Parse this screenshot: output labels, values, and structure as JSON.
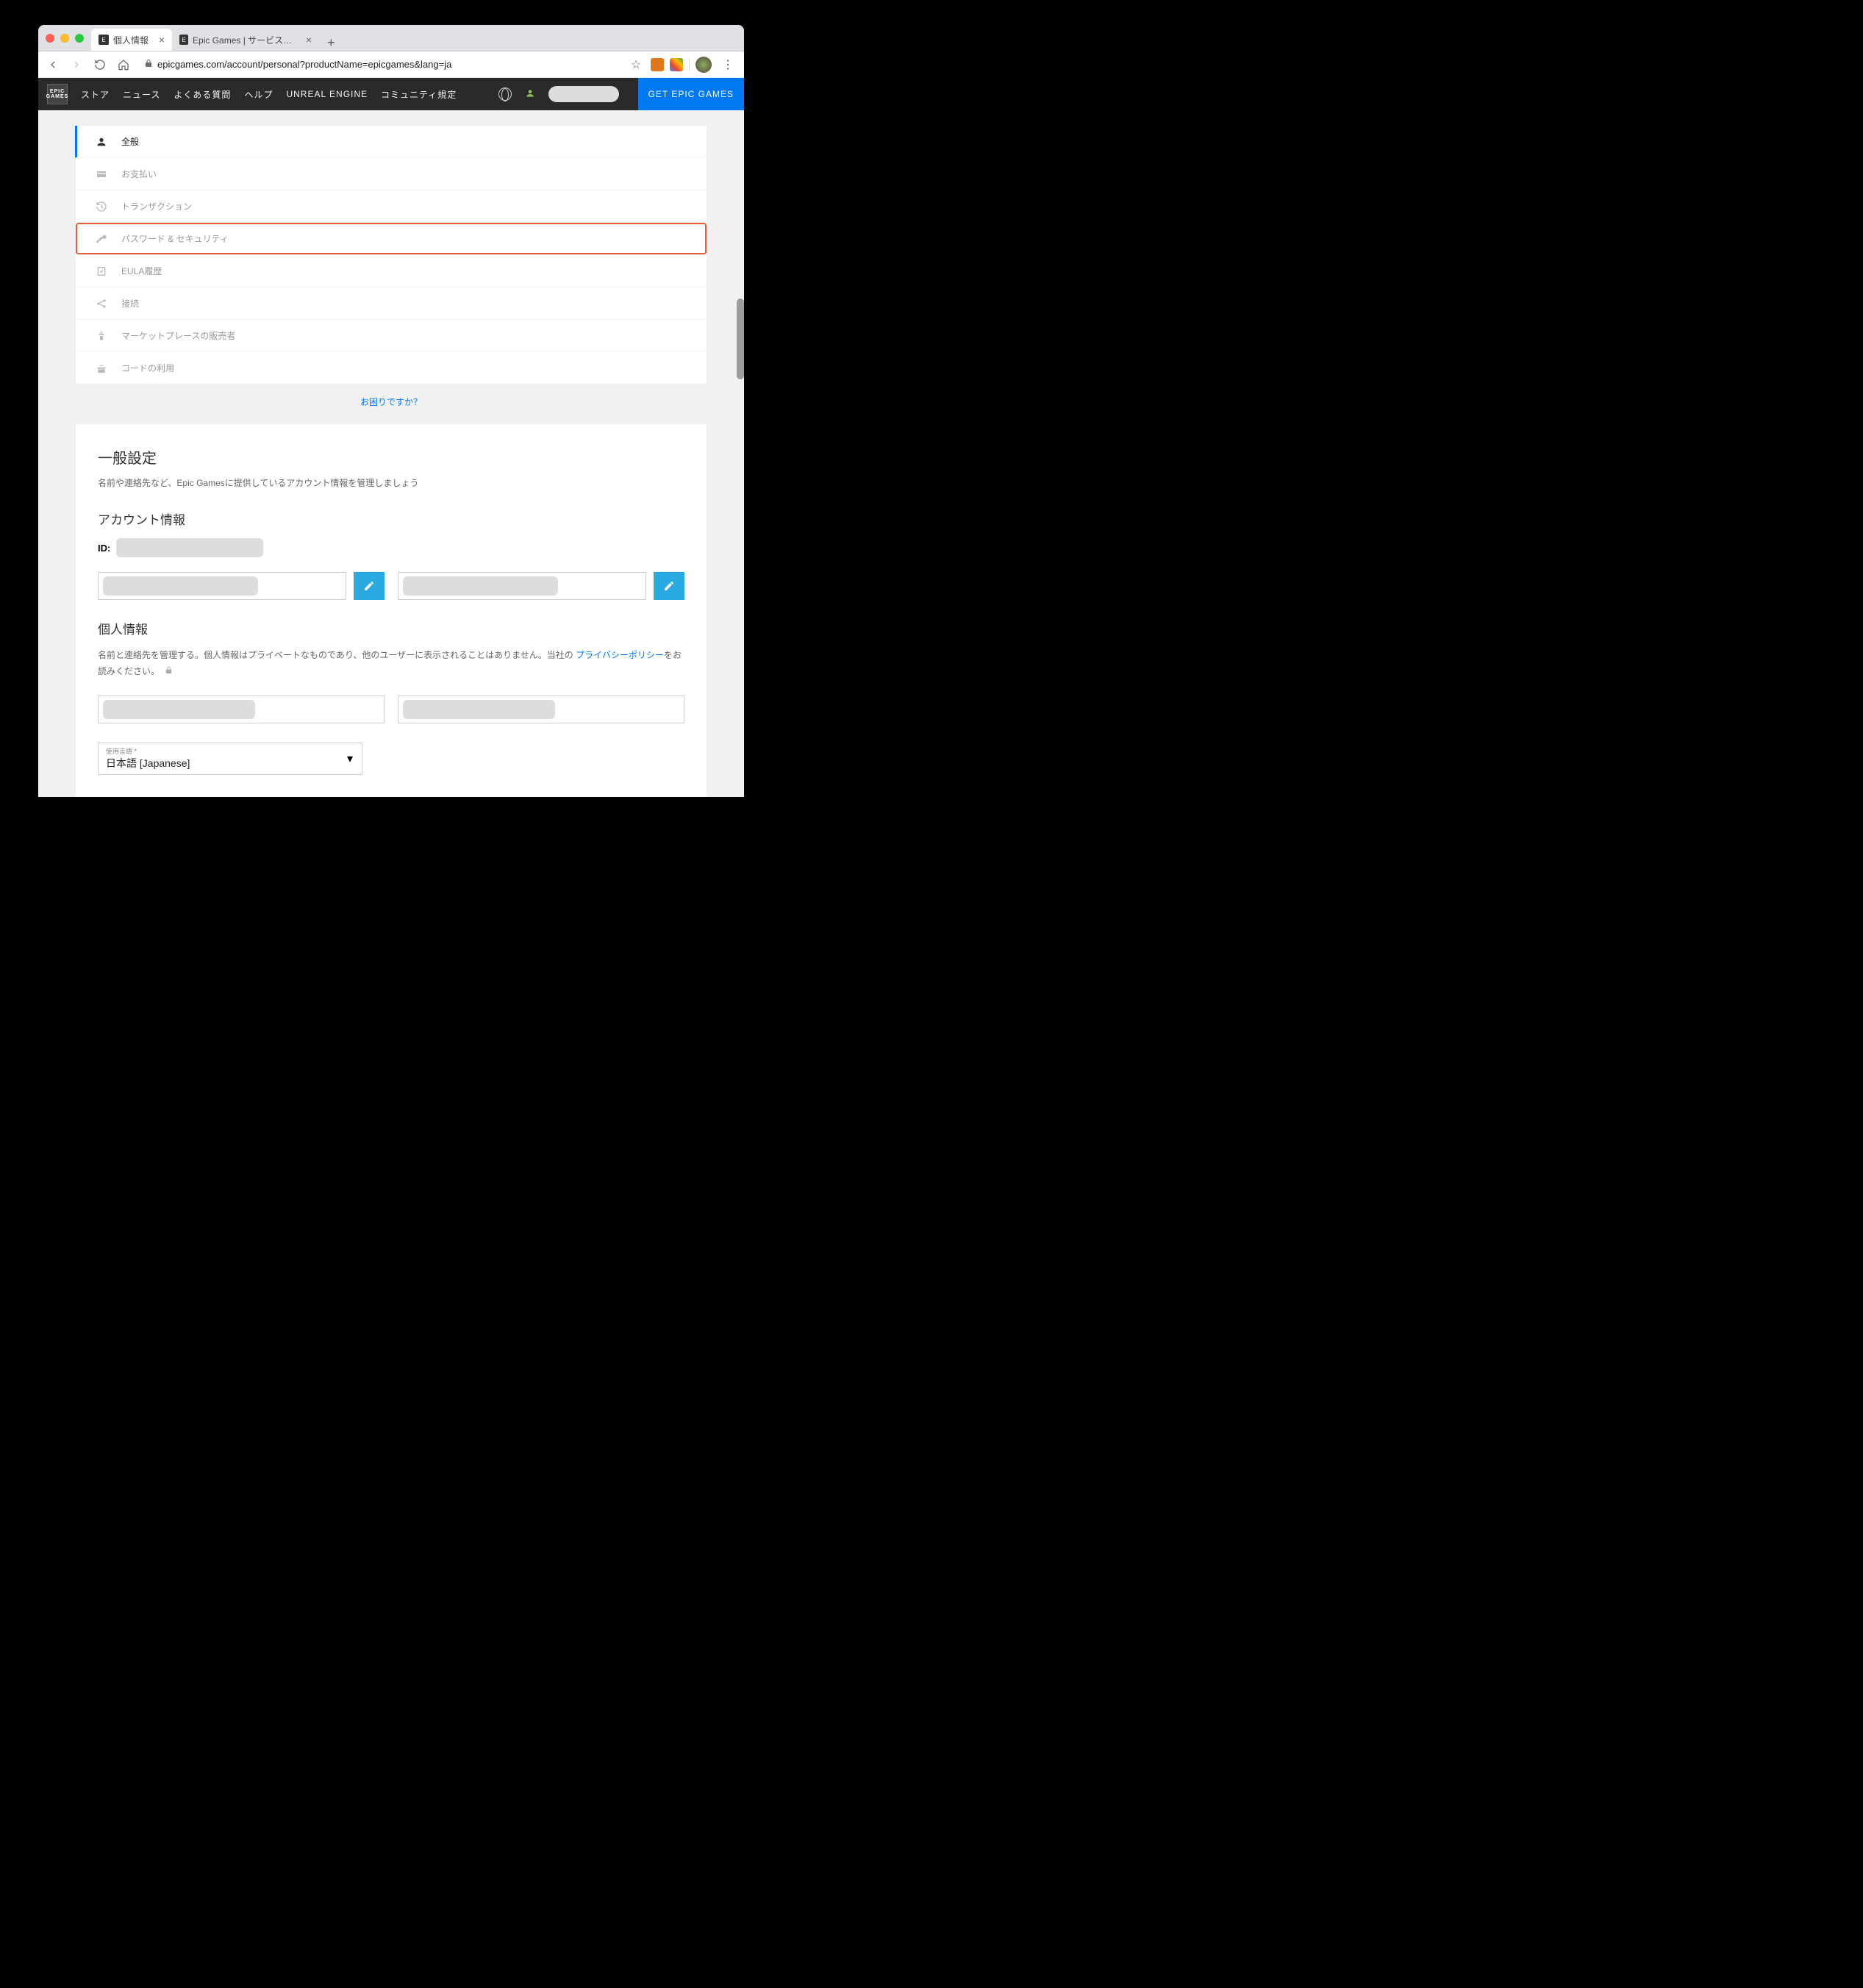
{
  "browser": {
    "tabs": [
      {
        "title": "個人情報",
        "active": true
      },
      {
        "title": "Epic Games | サービス利用規約",
        "active": false
      }
    ],
    "url": "epicgames.com/account/personal?productName=epicgames&lang=ja"
  },
  "topnav": {
    "items": [
      "ストア",
      "ニュース",
      "よくある質問",
      "ヘルプ",
      "UNREAL ENGINE",
      "コミュニティ規定"
    ],
    "cta": "GET EPIC GAMES"
  },
  "sidebar": {
    "items": [
      {
        "label": "全般",
        "icon": "person",
        "active": true
      },
      {
        "label": "お支払い",
        "icon": "payment"
      },
      {
        "label": "トランザクション",
        "icon": "history"
      },
      {
        "label": "パスワード & セキュリティ",
        "icon": "key",
        "highlight": true
      },
      {
        "label": "EULA履歴",
        "icon": "checklist"
      },
      {
        "label": "接続",
        "icon": "share"
      },
      {
        "label": "マーケットプレースの販売者",
        "icon": "seller"
      },
      {
        "label": "コードの利用",
        "icon": "gift"
      }
    ]
  },
  "help_link": "お困りですか？",
  "general": {
    "title": "一般設定",
    "subtitle": "名前や連絡先など、Epic Gamesに提供しているアカウント情報を管理しましょう",
    "account_heading": "アカウント情報",
    "id_label": "ID:",
    "personal_heading": "個人情報",
    "personal_desc_1": "名前と連絡先を管理する。個人情報はプライベートなものであり、他のユーザーに表示されることはありません。当社の ",
    "privacy_link": "プライバシーポリシー",
    "personal_desc_2": "をお読みください。",
    "language_label": "使用言語 *",
    "language_value": "日本語 [Japanese]"
  }
}
